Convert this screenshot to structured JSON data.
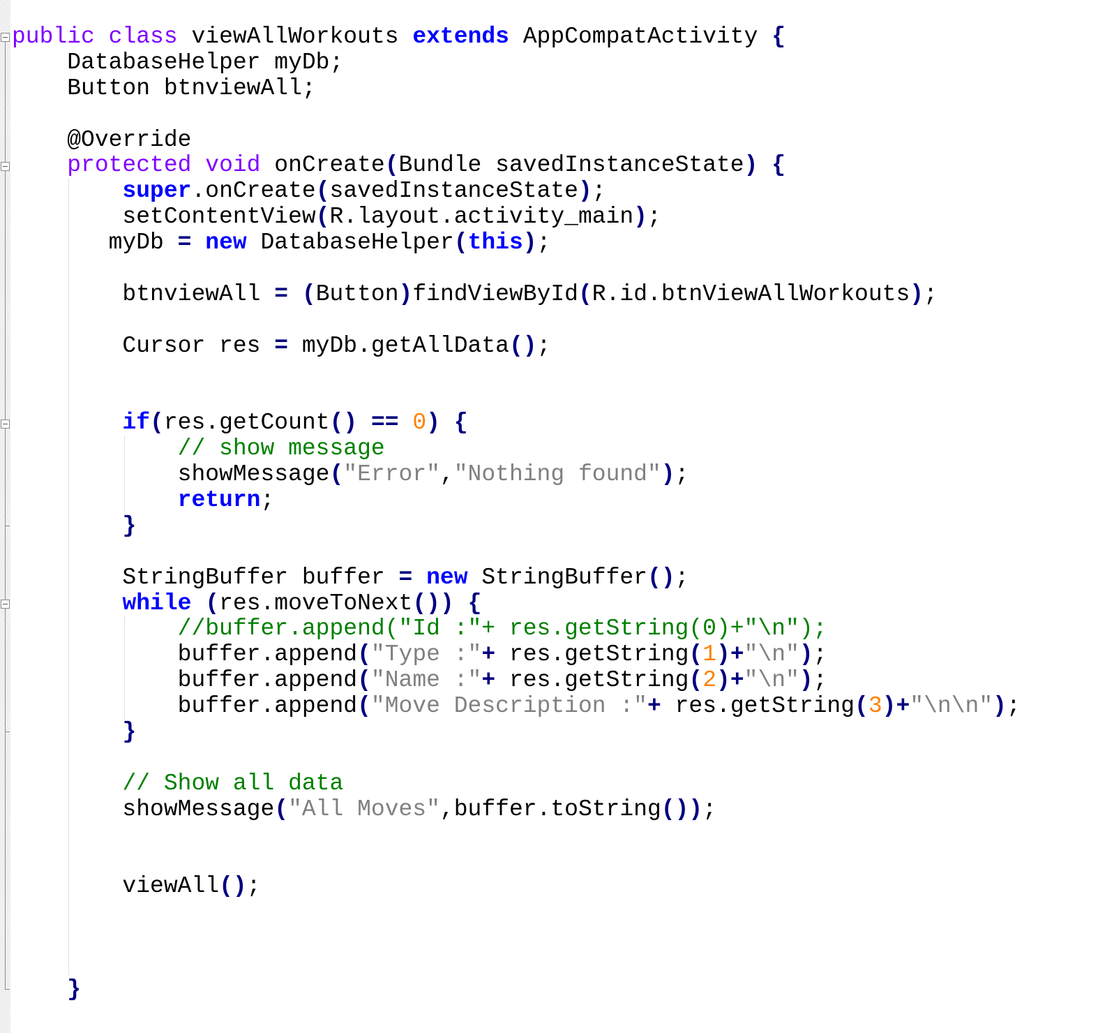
{
  "editor": {
    "language": "Java",
    "colors": {
      "keyword_type": "#8000FF",
      "keyword": "#0000FF",
      "operator": "#000080",
      "string": "#808080",
      "number": "#FF8000",
      "comment": "#008000"
    },
    "lines": [
      "public class viewAllWorkouts extends AppCompatActivity {",
      "    DatabaseHelper myDb;",
      "    Button btnviewAll;",
      "",
      "    @Override",
      "    protected void onCreate(Bundle savedInstanceState) {",
      "        super.onCreate(savedInstanceState);",
      "        setContentView(R.layout.activity_main);",
      "       myDb = new DatabaseHelper(this);",
      "",
      "        btnviewAll = (Button)findViewById(R.id.btnViewAllWorkouts);",
      "",
      "        Cursor res = myDb.getAllData();",
      "",
      "",
      "        if(res.getCount() == 0) {",
      "            // show message",
      "            showMessage(\"Error\",\"Nothing found\");",
      "            return;",
      "        }",
      "",
      "        StringBuffer buffer = new StringBuffer();",
      "        while (res.moveToNext()) {",
      "            //buffer.append(\"Id :\"+ res.getString(0)+\"\\n\");",
      "            buffer.append(\"Type :\"+ res.getString(1)+\"\\n\");",
      "            buffer.append(\"Name :\"+ res.getString(2)+\"\\n\");",
      "            buffer.append(\"Move Description :\"+ res.getString(3)+\"\\n\\n\");",
      "        }",
      "",
      "        // Show all data",
      "        showMessage(\"All Moves\",buffer.toString());",
      "",
      "",
      "        viewAll();",
      "",
      "",
      "",
      "    }"
    ]
  }
}
